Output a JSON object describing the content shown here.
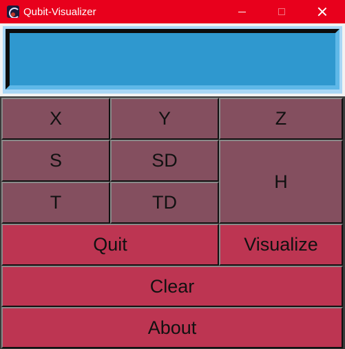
{
  "window": {
    "title": "Qubit-Visualizer",
    "icon": "qiskit-app-icon",
    "controls": [
      "minimize-icon",
      "maximize-icon",
      "close-icon"
    ]
  },
  "display": {
    "value": ""
  },
  "gates": {
    "x": "X",
    "y": "Y",
    "z": "Z",
    "s": "S",
    "sd": "SD",
    "h": "H",
    "t": "T",
    "td": "TD"
  },
  "actions": {
    "quit": "Quit",
    "visualize": "Visualize",
    "clear": "Clear",
    "about": "About"
  },
  "colors": {
    "titlebar": "#e8001c",
    "display": "#2f98cf",
    "gate_button": "#844f5f",
    "action_button": "#bd3552"
  }
}
